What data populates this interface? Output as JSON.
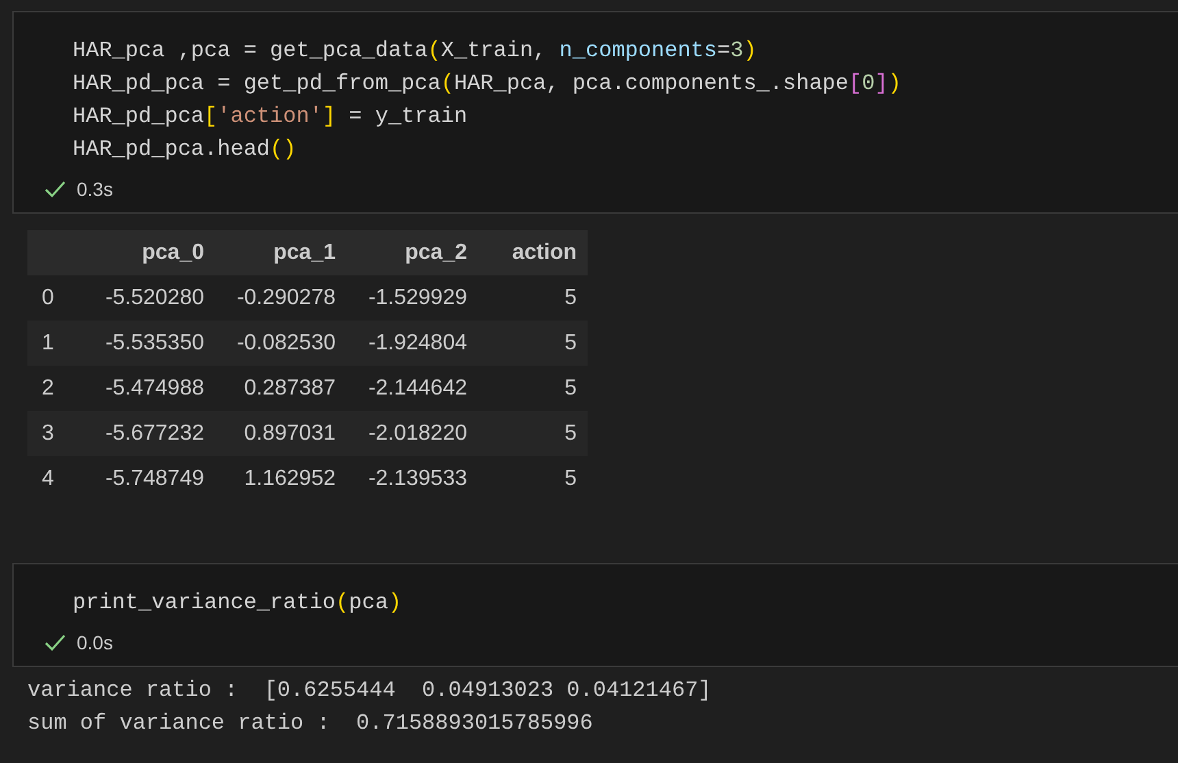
{
  "cells": [
    {
      "kind": "code",
      "lines": [
        [
          {
            "kind": "plain",
            "text": "HAR_pca ,pca = get_pca_data"
          },
          {
            "kind": "bracket1",
            "text": "("
          },
          {
            "kind": "plain",
            "text": "X_train, "
          },
          {
            "kind": "param",
            "text": "n_components"
          },
          {
            "kind": "plain",
            "text": "="
          },
          {
            "kind": "number",
            "text": "3"
          },
          {
            "kind": "bracket1",
            "text": ")"
          }
        ],
        [
          {
            "kind": "plain",
            "text": "HAR_pd_pca = get_pd_from_pca"
          },
          {
            "kind": "bracket1",
            "text": "("
          },
          {
            "kind": "plain",
            "text": "HAR_pca, pca.components_.shape"
          },
          {
            "kind": "bracket2",
            "text": "["
          },
          {
            "kind": "number",
            "text": "0"
          },
          {
            "kind": "bracket2",
            "text": "]"
          },
          {
            "kind": "bracket1",
            "text": ")"
          }
        ],
        [
          {
            "kind": "plain",
            "text": "HAR_pd_pca"
          },
          {
            "kind": "bracket1",
            "text": "["
          },
          {
            "kind": "string",
            "text": "'action'"
          },
          {
            "kind": "bracket1",
            "text": "]"
          },
          {
            "kind": "plain",
            "text": " = y_train"
          }
        ],
        [
          {
            "kind": "plain",
            "text": "HAR_pd_pca.head"
          },
          {
            "kind": "bracket1",
            "text": "()"
          }
        ]
      ],
      "status": {
        "time": "0.3s"
      },
      "output": {
        "kind": "table",
        "columns": [
          "pca_0",
          "pca_1",
          "pca_2",
          "action"
        ],
        "rows": [
          {
            "index": "0",
            "cells": [
              "-5.520280",
              "-0.290278",
              "-1.529929",
              "5"
            ]
          },
          {
            "index": "1",
            "cells": [
              "-5.535350",
              "-0.082530",
              "-1.924804",
              "5"
            ]
          },
          {
            "index": "2",
            "cells": [
              "-5.474988",
              "0.287387",
              "-2.144642",
              "5"
            ]
          },
          {
            "index": "3",
            "cells": [
              "-5.677232",
              "0.897031",
              "-2.018220",
              "5"
            ]
          },
          {
            "index": "4",
            "cells": [
              "-5.748749",
              "1.162952",
              "-2.139533",
              "5"
            ]
          }
        ]
      }
    },
    {
      "kind": "code",
      "lines": [
        [
          {
            "kind": "plain",
            "text": "print_variance_ratio"
          },
          {
            "kind": "bracket1",
            "text": "("
          },
          {
            "kind": "plain",
            "text": "pca"
          },
          {
            "kind": "bracket1",
            "text": ")"
          }
        ]
      ],
      "status": {
        "time": "0.0s"
      },
      "output": {
        "kind": "stream",
        "lines": [
          "variance ratio :  [0.6255444  0.04913023 0.04121467]",
          "sum of variance ratio :  0.7158893015785996"
        ]
      }
    }
  ]
}
